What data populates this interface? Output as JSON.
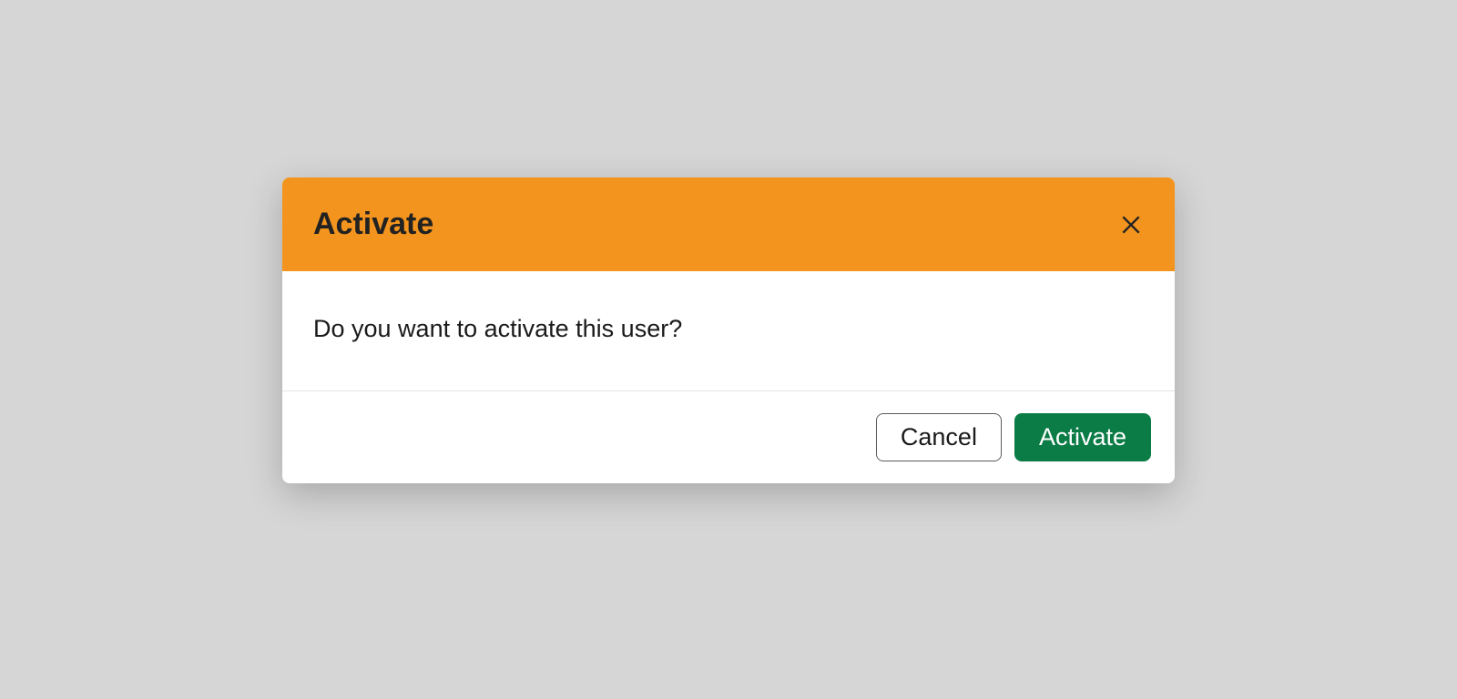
{
  "dialog": {
    "title": "Activate",
    "message": "Do you want to activate this user?",
    "cancel_label": "Cancel",
    "confirm_label": "Activate"
  },
  "colors": {
    "header_bg": "#f2941e",
    "confirm_bg": "#0c7c47",
    "page_bg": "#d6d6d6"
  }
}
